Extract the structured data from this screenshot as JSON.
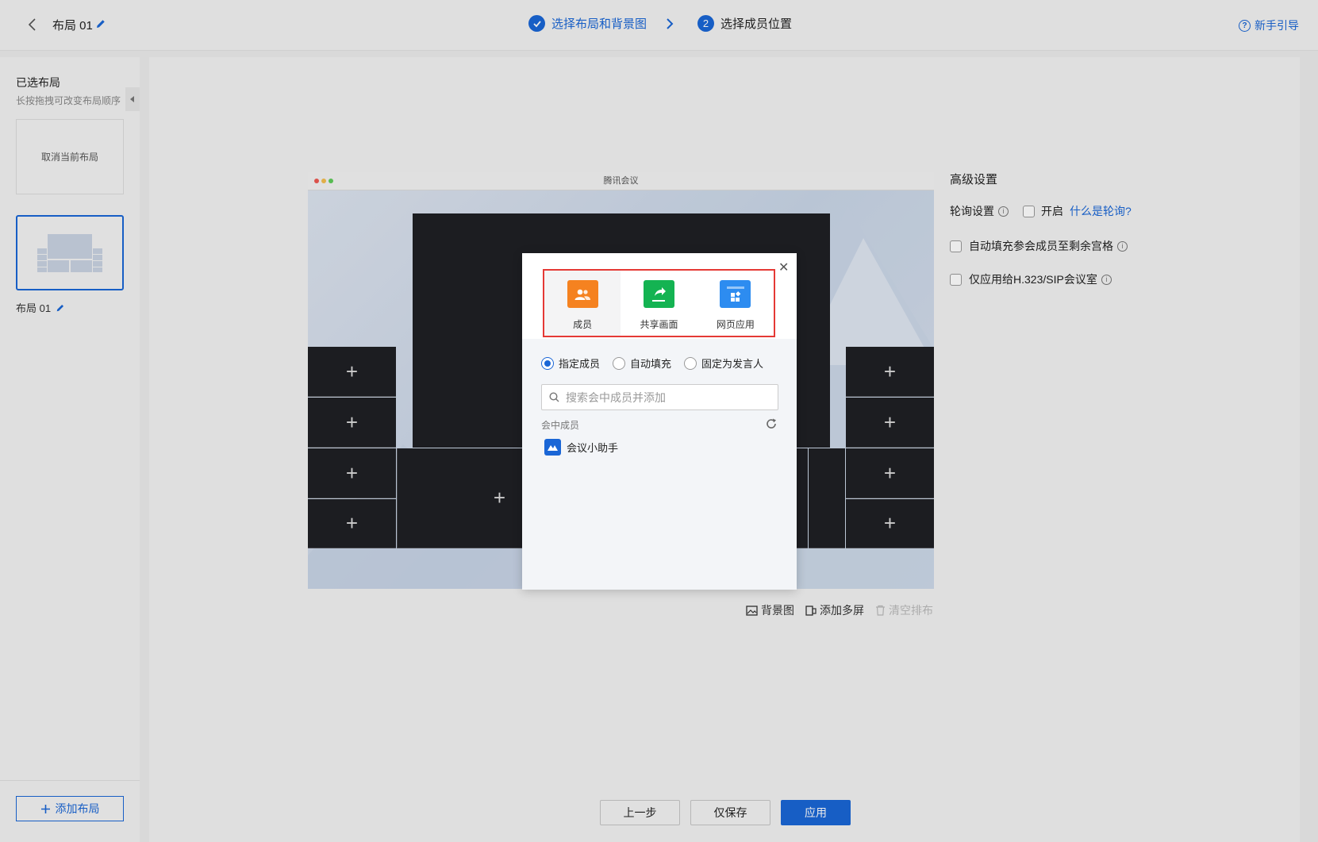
{
  "header": {
    "title": "布局 01",
    "step1_label": "选择布局和背景图",
    "step2_number": "2",
    "step2_label": "选择成员位置",
    "guide_label": "新手引导"
  },
  "sidebar": {
    "title": "已选布局",
    "subtitle": "长按拖拽可改变布局顺序",
    "cancel_label": "取消当前布局",
    "layout_name": "布局 01",
    "add_label": "添加布局"
  },
  "preview": {
    "window_title": "腾讯会议",
    "tools": {
      "background": "背景图",
      "multi_screen": "添加多屏",
      "clear": "清空排布"
    }
  },
  "advanced": {
    "title": "高级设置",
    "polling_label": "轮询设置",
    "enable_label": "开启",
    "what_is_polling": "什么是轮询?",
    "autofill_label": "自动填充参会成员至剩余宫格",
    "h323_label": "仅应用给H.323/SIP会议室"
  },
  "footer": {
    "prev_label": "上一步",
    "save_label": "仅保存",
    "apply_label": "应用"
  },
  "modal": {
    "sources": [
      {
        "label": "成员",
        "icon": "members-icon"
      },
      {
        "label": "共享画面",
        "icon": "share-screen-icon"
      },
      {
        "label": "网页应用",
        "icon": "web-app-icon"
      }
    ],
    "modes": [
      "指定成员",
      "自动填充",
      "固定为发言人"
    ],
    "search_placeholder": "搜索会中成员并添加",
    "members_label": "会中成员",
    "member_name": "会议小助手"
  },
  "colors": {
    "accent": "#1a66d6",
    "highlight": "#e53935",
    "members_icon": "#f58220",
    "share_icon": "#14b352",
    "web_icon": "#2d8cf0",
    "tile": "#1f2024"
  }
}
